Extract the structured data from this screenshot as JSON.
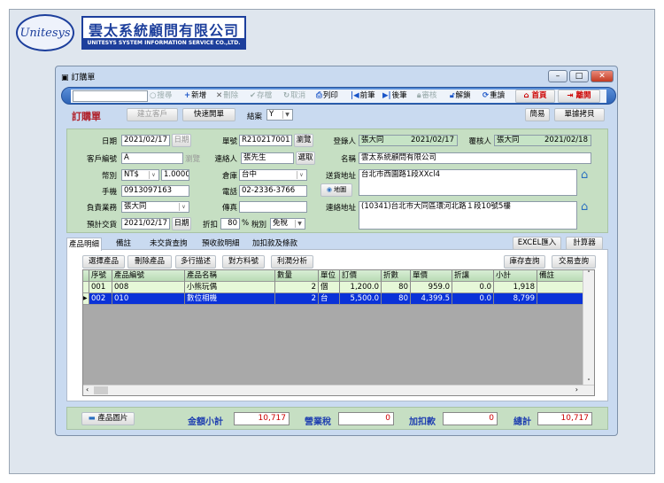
{
  "logo": {
    "brand": "Unitesys",
    "company_cn": "雲太系統顧問有限公司",
    "company_en": "UNITESYS SYSTEM INFORMATION SERVICE CO.,LTD."
  },
  "window": {
    "title": "訂購單"
  },
  "toolbar": {
    "search_value": "",
    "search": "搜尋",
    "new": "新增",
    "delete": "刪除",
    "save": "存檔",
    "cancel": "取消",
    "print": "列印",
    "prev": "前筆",
    "next": "後筆",
    "audit": "審核",
    "unlock": "解鎖",
    "reload": "重讀",
    "home": "首頁",
    "exit": "離開"
  },
  "header": {
    "form_title": "訂購單",
    "create_customer": "建立客戶",
    "quick_order": "快速開單",
    "closed_label": "結案",
    "closed_value": "Y",
    "simple": "簡易",
    "copy_doc": "單據拷貝"
  },
  "form": {
    "date_label": "日期",
    "date": "2021/02/17",
    "date_btn": "日期",
    "order_no_label": "單號",
    "order_no": "R210217001",
    "browse": "瀏覽",
    "creator_label": "登錄人",
    "creator": "張大同",
    "creator_date": "2021/02/17",
    "reviewer_label": "覆核人",
    "reviewer": "張大同",
    "reviewer_date": "2021/02/18",
    "customer_no_label": "客戶編號",
    "customer_no": "A",
    "customer_browse": "瀏覽",
    "contact_label": "連絡人",
    "contact": "張先生",
    "pick": "選取",
    "name_label": "名稱",
    "name": "雲太系統顧問有限公司",
    "currency_label": "幣別",
    "currency": "NT$",
    "rate": "1.0000",
    "warehouse_label": "倉庫",
    "warehouse": "台中",
    "ship_addr_label": "送貨地址",
    "ship_addr": "台北市西園路1段XXcl4",
    "mobile_label": "手機",
    "mobile": "0913097163",
    "phone_label": "電話",
    "phone": "02-2336-3766",
    "map": "地圖",
    "sales_label": "負責業務",
    "sales": "張大同",
    "fax_label": "傳真",
    "fax": "",
    "contact_addr_label": "連絡地址",
    "contact_addr": "(10341)台北市大同區環河北路１段10號5樓",
    "delivery_label": "預計交貨",
    "delivery": "2021/02/17",
    "delivery_btn": "日期",
    "discount_label": "折扣",
    "discount": "80",
    "percent": "%",
    "tax_label": "稅別",
    "tax": "免稅"
  },
  "tabs": [
    "產品明細",
    "備註",
    "未交貨查詢",
    "預收款明細",
    "加扣款及條款"
  ],
  "tab_tools": {
    "excel": "EXCEL匯入",
    "calc": "計算器"
  },
  "product_buttons": {
    "select": "選擇產品",
    "remove": "刪除產品",
    "multiline": "多行描述",
    "partner_no": "對方料號",
    "profit": "利潤分析",
    "stock": "庫存查詢",
    "trade": "交易查詢"
  },
  "grid": {
    "columns": [
      "序號",
      "產品編號",
      "產品名稱",
      "數量",
      "單位",
      "訂價",
      "折數",
      "單價",
      "折讓",
      "小計",
      "備註"
    ],
    "rows": [
      [
        "001",
        "008",
        "小熊玩偶",
        "2",
        "個",
        "1,200.0",
        "80",
        "959.0",
        "0.0",
        "1,918",
        ""
      ],
      [
        "002",
        "010",
        "數位相機",
        "2",
        "台",
        "5,500.0",
        "80",
        "4,399.5",
        "0.0",
        "8,799",
        ""
      ]
    ]
  },
  "totals": {
    "image_btn": "產品圖片",
    "subtotal_label": "金額小計",
    "subtotal": "10,717",
    "tax_label": "營業稅",
    "tax": "0",
    "adjust_label": "加扣款",
    "adjust": "0",
    "total_label": "總計",
    "total": "10,717"
  }
}
